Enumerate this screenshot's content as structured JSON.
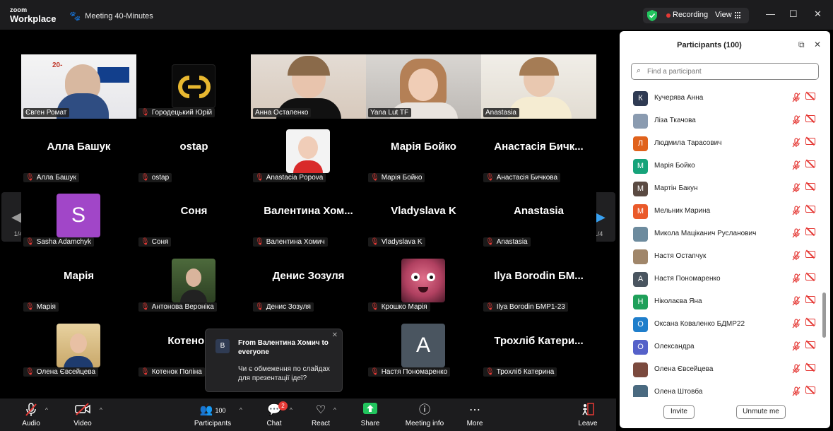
{
  "titlebar": {
    "brand_line1": "zoom",
    "brand_line2": "Workplace",
    "meeting_title": "Meeting 40-Minutes",
    "recording_label": "Recording",
    "view_label": "View"
  },
  "gallery": {
    "page_indicator_left": "1/4",
    "page_indicator_right": "1/4",
    "tiles": [
      {
        "name": "Євген Ромат",
        "big": "",
        "kind": "video-man",
        "active": true
      },
      {
        "name": "Городецький Юрій",
        "big": "",
        "kind": "logo"
      },
      {
        "name": "Анна Остапенко",
        "big": "",
        "kind": "video-woman1"
      },
      {
        "name": "Yana Lut TF",
        "big": "",
        "kind": "video-woman2"
      },
      {
        "name": "Anastasia",
        "big": "",
        "kind": "video-woman3"
      },
      {
        "name": "Алла Башук",
        "big": "Алла Башук",
        "kind": "text"
      },
      {
        "name": "ostap",
        "big": "ostap",
        "kind": "text"
      },
      {
        "name": "Anastacia Popova",
        "big": "",
        "kind": "photo-popova"
      },
      {
        "name": "Марія Бойко",
        "big": "Марія Бойко",
        "kind": "text"
      },
      {
        "name": "Анастасія Бичкова",
        "big": "Анастасія Бичк...",
        "kind": "text"
      },
      {
        "name": "Sasha Adamchyk",
        "big": "",
        "kind": "letter-s",
        "letter": "S"
      },
      {
        "name": "Соня",
        "big": "Соня",
        "kind": "text"
      },
      {
        "name": "Валентина Хомич",
        "big": "Валентина  Хом...",
        "kind": "text"
      },
      {
        "name": "Vladyslava K",
        "big": "Vladyslava K",
        "kind": "text"
      },
      {
        "name": "Anastasia",
        "big": "Anastasia",
        "kind": "text"
      },
      {
        "name": "Марія",
        "big": "Марія",
        "kind": "text"
      },
      {
        "name": "Антонова Вероніка",
        "big": "",
        "kind": "photo-veronika"
      },
      {
        "name": "Денис Зозуля",
        "big": "Денис Зозуля",
        "kind": "text"
      },
      {
        "name": "Крошко Марія",
        "big": "",
        "kind": "photo-monster"
      },
      {
        "name": "Ilya Borodin БМР1-23",
        "big": "Ilya Borodin БМ...",
        "kind": "text"
      },
      {
        "name": "Олена Євсейцева",
        "big": "",
        "kind": "photo-olena"
      },
      {
        "name": "Котенок Поліна",
        "big": "Котенок П",
        "kind": "text"
      },
      {
        "name": "",
        "big": "",
        "kind": "hidden"
      },
      {
        "name": "Настя Пономаренко",
        "big": "",
        "kind": "letter-a",
        "letter": "A"
      },
      {
        "name": "Трохліб Катерина",
        "big": "Трохліб  Катери...",
        "kind": "text"
      }
    ]
  },
  "chat_popup": {
    "avatar_letter": "В",
    "from": "From Валентина Хомич to everyone",
    "message": "Чи є обмеження по слайдах для презентації ідеї?"
  },
  "toolbar": {
    "audio": "Audio",
    "video": "Video",
    "participants": "Participants",
    "participants_count": "100",
    "chat": "Chat",
    "chat_badge": "2",
    "react": "React",
    "share": "Share",
    "meeting_info": "Meeting info",
    "more": "More",
    "leave": "Leave"
  },
  "panel": {
    "title": "Participants (100)",
    "search_placeholder": "Find a participant",
    "invite": "Invite",
    "unmute_me": "Unmute me",
    "participants": [
      {
        "name": "Кучерява Анна",
        "letter": "К",
        "color": "#2f3b53"
      },
      {
        "name": "Ліза Ткачова",
        "letter": "",
        "color": "#8a9bb0"
      },
      {
        "name": "Людмила Тарасович",
        "letter": "Л",
        "color": "#e0621c"
      },
      {
        "name": "Марія Бойко",
        "letter": "М",
        "color": "#16a37a"
      },
      {
        "name": "Мартін Бакун",
        "letter": "М",
        "color": "#5a4a42"
      },
      {
        "name": "Мельник Марина",
        "letter": "М",
        "color": "#ea5a2a"
      },
      {
        "name": "Микола Маціканич Русланович",
        "letter": "",
        "color": "#6d8b9e"
      },
      {
        "name": "Настя Остапчук",
        "letter": "",
        "color": "#a0866a"
      },
      {
        "name": "Настя Пономаренко",
        "letter": "А",
        "color": "#4a5560"
      },
      {
        "name": "Ніколаєва Яна",
        "letter": "Н",
        "color": "#1fa05a"
      },
      {
        "name": "Оксана Коваленко БДМР22",
        "letter": "О",
        "color": "#1f7ecb"
      },
      {
        "name": "Олександра",
        "letter": "О",
        "color": "#5561c9"
      },
      {
        "name": "Олена Євсейцева",
        "letter": "",
        "color": "#7b4a3e"
      },
      {
        "name": "Олена Штовба",
        "letter": "",
        "color": "#4a6a80"
      }
    ]
  }
}
